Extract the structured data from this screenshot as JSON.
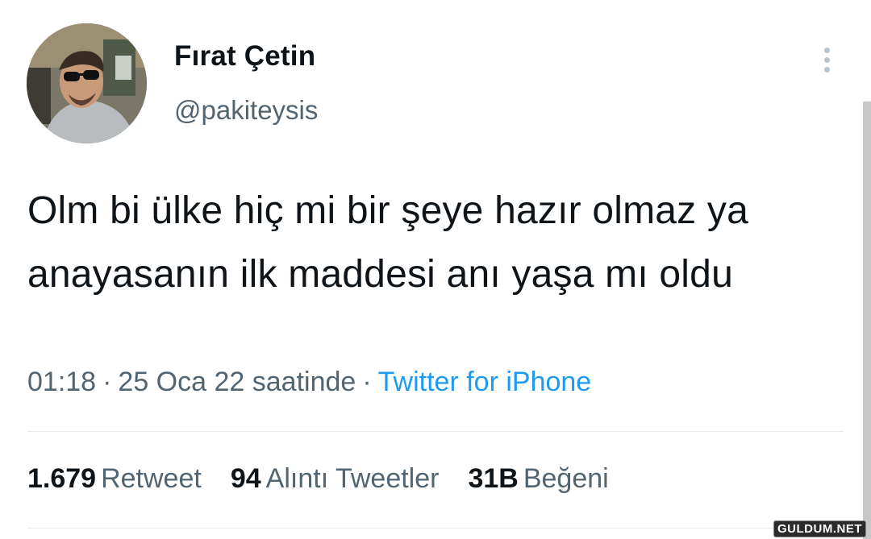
{
  "user": {
    "display_name": "Fırat Çetin",
    "handle": "@pakiteysis"
  },
  "tweet": {
    "text": "Olm bi ülke hiç mi bir şeye hazır olmaz ya anayasanın ilk maddesi anı yaşa mı oldu",
    "time": "01:18",
    "date": "25 Oca 22 saatinde",
    "separator": "·",
    "source": "Twitter for iPhone"
  },
  "stats": {
    "retweets": {
      "count": "1.679",
      "label": "Retweet"
    },
    "quotes": {
      "count": "94",
      "label": "Alıntı Tweetler"
    },
    "likes": {
      "count": "31B",
      "label": "Beğeni"
    }
  },
  "icons": {
    "more": "more-vertical-icon"
  },
  "watermark": "GULDUM.NET",
  "colors": {
    "text_primary": "#0f1419",
    "text_secondary": "#536471",
    "link": "#1d9bf0",
    "divider": "#e6ecf0"
  }
}
